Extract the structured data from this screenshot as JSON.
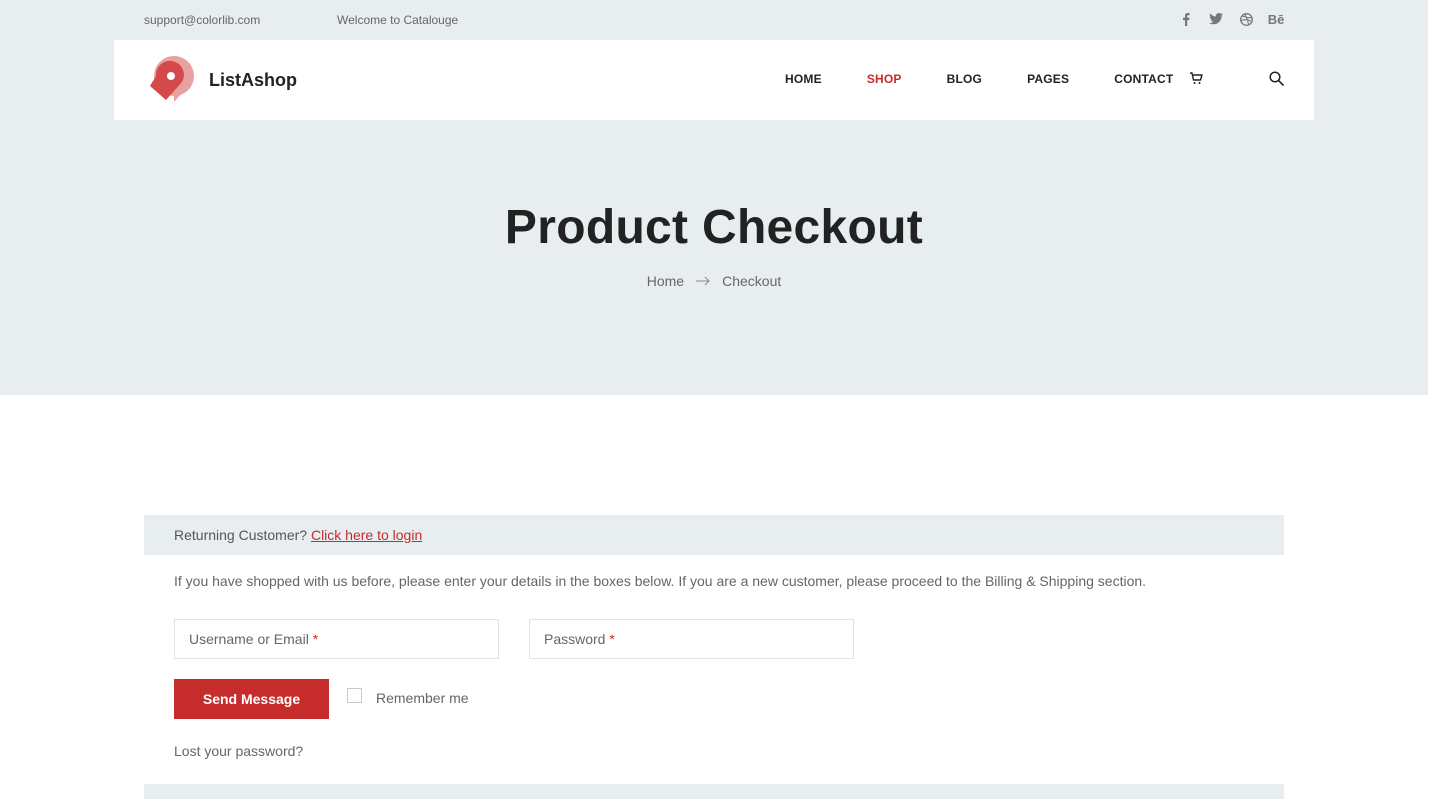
{
  "topbar": {
    "email": "support@colorlib.com",
    "welcome": "Welcome to Catalouge",
    "socials": [
      "facebook-icon",
      "twitter-icon",
      "dribbble-icon",
      "behance-icon"
    ],
    "behance_text": "Bē"
  },
  "header": {
    "brand": "ListAshop",
    "menu": [
      {
        "label": "HOME",
        "active": false
      },
      {
        "label": "SHOP",
        "active": true
      },
      {
        "label": "BLOG",
        "active": false
      },
      {
        "label": "PAGES",
        "active": false
      },
      {
        "label": "CONTACT",
        "active": false
      }
    ]
  },
  "hero": {
    "title": "Product Checkout",
    "breadcrumb": [
      "Home",
      "Checkout"
    ]
  },
  "login": {
    "returning_prefix": "Returning Customer?",
    "returning_link": "Click here to login",
    "info": "If you have shopped with us before, please enter your details in the boxes below. If you are a new customer, please proceed to the Billing & Shipping section.",
    "username_placeholder": "Username or Email",
    "password_placeholder": "Password",
    "required_mark": "*",
    "send_button": "Send Message",
    "remember_label": "Remember me",
    "lost_password": "Lost your password?"
  },
  "colors": {
    "accent": "#c72c2c",
    "hero_bg": "#e8eef0",
    "text": "#222222"
  }
}
